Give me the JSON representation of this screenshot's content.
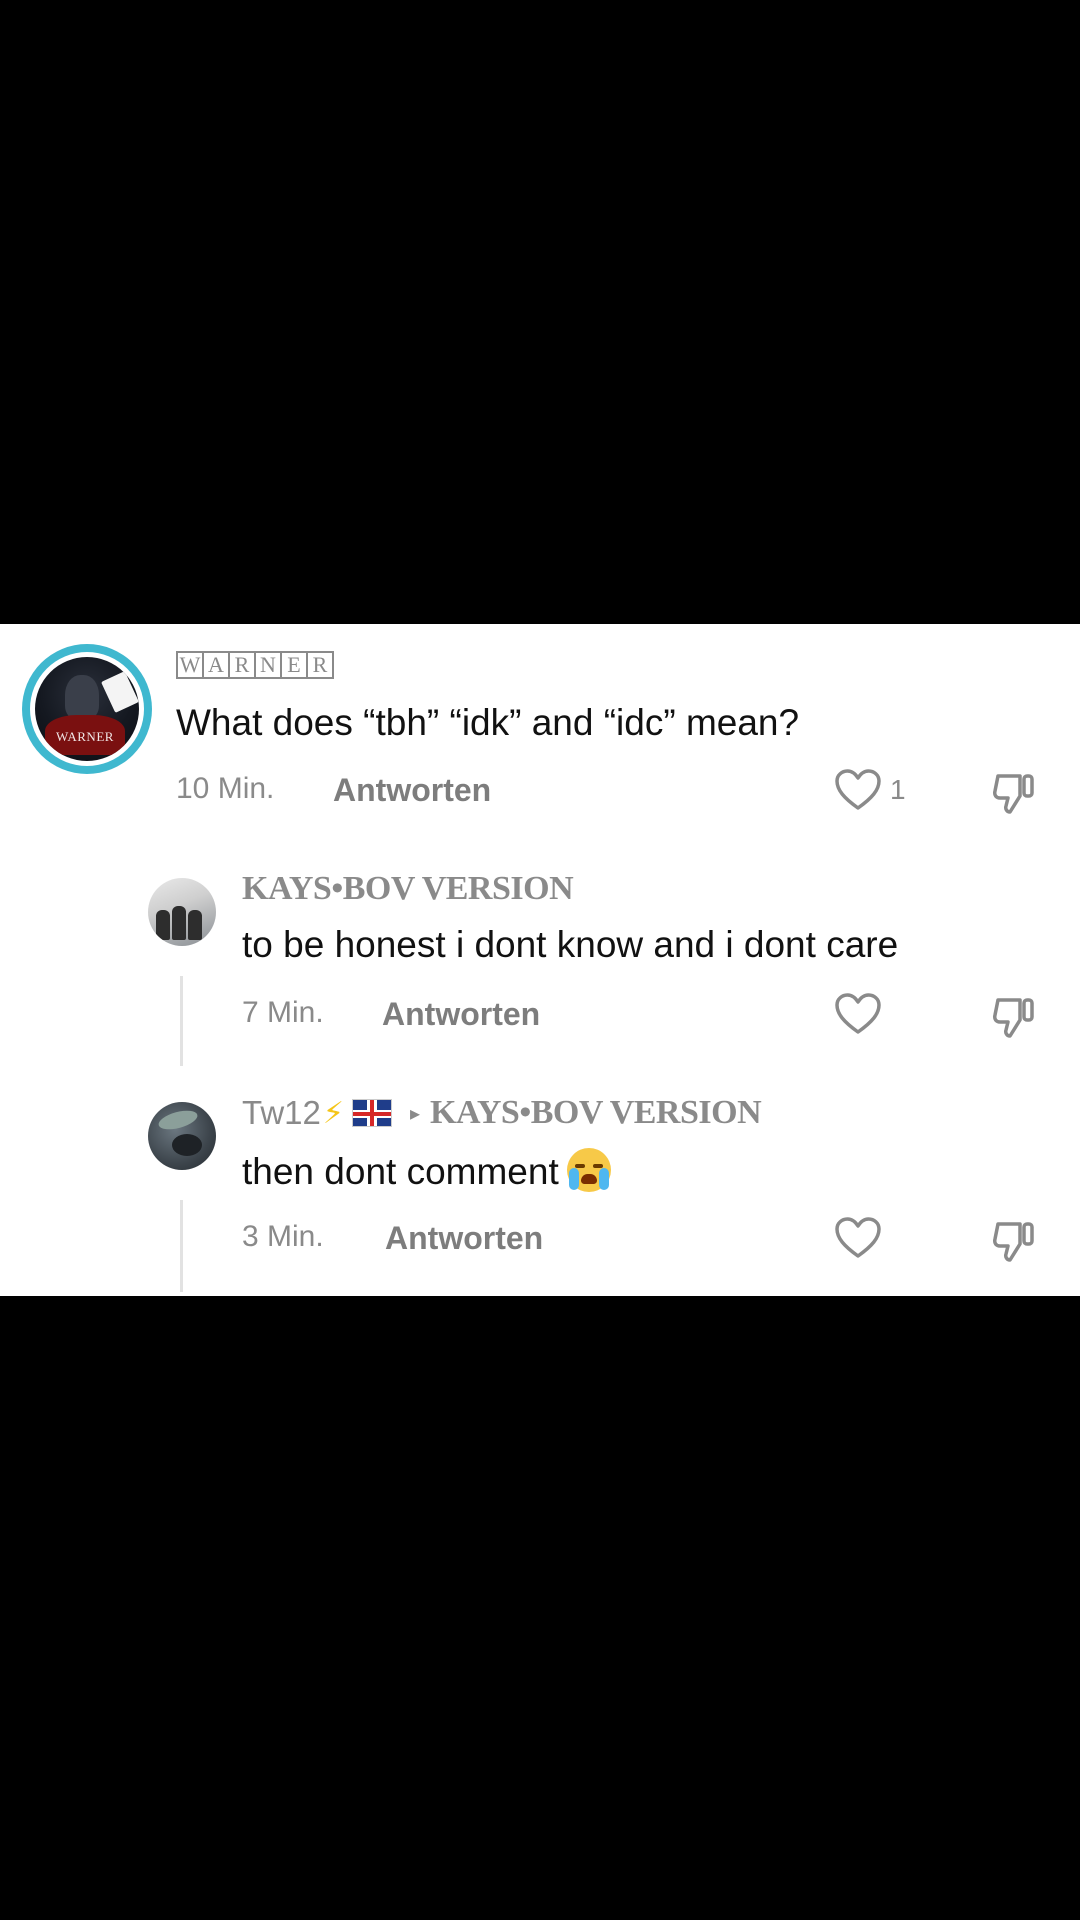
{
  "comments": [
    {
      "username_letters": [
        "W",
        "A",
        "R",
        "N",
        "E",
        "R"
      ],
      "avatar_text": "WARNER",
      "text": "What does “tbh” “idk” and “idc” mean?",
      "time": "10 Min.",
      "reply_label": "Antworten",
      "likes": "1"
    },
    {
      "username": "KAYS•BOV VERSION",
      "text": "to be honest i dont know and i dont care",
      "time": "7 Min.",
      "reply_label": "Antworten"
    },
    {
      "username": "Tw12",
      "username_bolt": "⚡",
      "reply_arrow": "▸",
      "reply_to": "KAYS•BOV VERSION",
      "text": "then dont comment",
      "time": "3 Min.",
      "reply_label": "Antworten"
    }
  ],
  "colors": {
    "background": "#000000",
    "panel": "#ffffff",
    "muted": "#8a8a8a",
    "text": "#111111",
    "avatar_ring": "#3fb8cf"
  },
  "icons": [
    "heart-icon",
    "dislike-icon",
    "crying-face-emoji",
    "uk-flag-icon",
    "lightning-icon"
  ]
}
